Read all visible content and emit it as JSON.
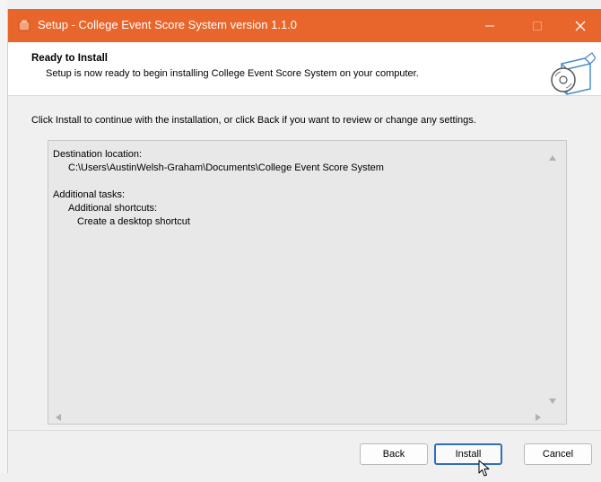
{
  "window": {
    "title": "Setup - College Event Score System version 1.1.0",
    "accent_color": "#e8662c",
    "icons": {
      "app": "installer-app-icon",
      "minimize": "minimize-icon",
      "maximize": "maximize-icon",
      "close": "close-icon"
    }
  },
  "header": {
    "title": "Ready to Install",
    "subtitle": "Setup is now ready to begin installing College Event Score System on your computer.",
    "icon": "install-disc-box-icon"
  },
  "instruction": "Click Install to continue with the installation, or click Back if you want to review or change any settings.",
  "memo": {
    "lines": [
      "Destination location:",
      "C:\\Users\\AustinWelsh-Graham\\Documents\\College Event Score System",
      "",
      "Additional tasks:",
      "Additional shortcuts:",
      "Create a desktop shortcut"
    ]
  },
  "buttons": {
    "back": "Back",
    "install": "Install",
    "cancel": "Cancel"
  }
}
